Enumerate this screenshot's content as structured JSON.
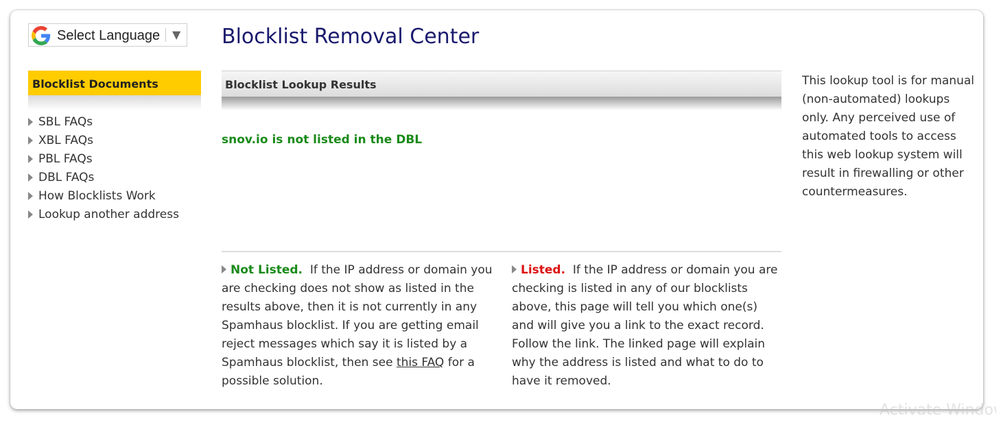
{
  "language_selector": {
    "label": "Select Language",
    "arrow": "▼",
    "logo_icon": "google-g-icon"
  },
  "page": {
    "title": "Blocklist Removal Center"
  },
  "sidebar": {
    "heading": "Blocklist Documents",
    "heading_color": "#ffcc00",
    "items": [
      {
        "label": "SBL FAQs"
      },
      {
        "label": "XBL FAQs"
      },
      {
        "label": "PBL FAQs"
      },
      {
        "label": "DBL FAQs"
      },
      {
        "label": "How Blocklists Work"
      },
      {
        "label": "Lookup another address"
      }
    ]
  },
  "results": {
    "heading": "Blocklist Lookup Results",
    "message": "snov.io is not listed in the DBL",
    "message_color": "#1a8a1a"
  },
  "legend": {
    "not_listed": {
      "label": "Not Listed.",
      "text_before": "If the IP address or domain you are checking does not show as listed in the results above, then it is not currently in any Spamhaus blocklist. If you are getting email reject messages which say it is listed by a Spamhaus blocklist, then see",
      "link": "this FAQ",
      "text_after": "for a possible solution."
    },
    "listed": {
      "label": "Listed.",
      "text": "If the IP address or domain you are checking is listed in any of our blocklists above, this page will tell you which one(s) and will give you a link to the exact record. Follow the link. The linked page will explain why the address is listed and what to do to have it removed."
    }
  },
  "notice": {
    "text": "This lookup tool is for manual (non-automated) lookups only. Any perceived use of automated tools to access this web lookup system will result in firewalling or other countermeasures."
  },
  "watermark": {
    "text": "Activate Windows"
  }
}
